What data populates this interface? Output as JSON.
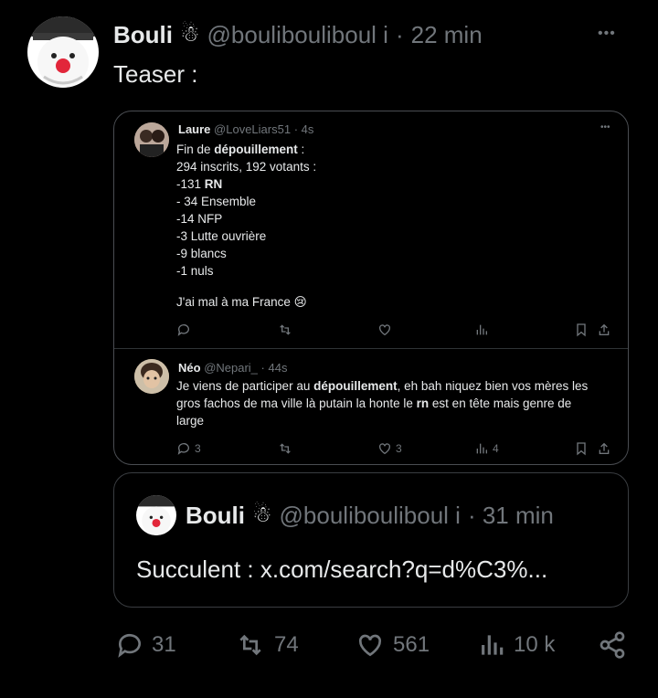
{
  "main": {
    "author_name": "Bouli",
    "author_handle": "@boulibouliboul i",
    "separator": "·",
    "time": "22 min",
    "more": "•••",
    "text": "Teaser :"
  },
  "quoted": {
    "tweet1": {
      "name": "Laure",
      "handle": "@LoveLiars51",
      "time": "· 4s",
      "lines": [
        {
          "pre": "Fin de ",
          "b": "dépouillement",
          "post": " :"
        },
        {
          "pre": "294 inscrits, 192 votants :",
          "b": "",
          "post": ""
        },
        {
          "pre": "-131 ",
          "b": "RN",
          "post": ""
        },
        {
          "pre": "- 34 Ensemble",
          "b": "",
          "post": ""
        },
        {
          "pre": "-14 NFP",
          "b": "",
          "post": ""
        },
        {
          "pre": "-3 Lutte ouvrière",
          "b": "",
          "post": ""
        },
        {
          "pre": "-9 blancs",
          "b": "",
          "post": ""
        },
        {
          "pre": "-1 nuls",
          "b": "",
          "post": ""
        }
      ],
      "last_line": "J'ai mal à ma France 😢"
    },
    "tweet2": {
      "name": "Néo",
      "handle": "@Nepari_",
      "time": "· 44s",
      "line1_pre": "Je viens de participer au ",
      "line1_b": "dépouillement",
      "line1_post": ", eh bah niquez bien vos mères les",
      "line2_pre": "gros fachos de ma ville là putain la honte le ",
      "line2_b": "rn",
      "line2_post": " est en tête mais genre de",
      "line3": "large",
      "replies": "3",
      "likes": "3",
      "views": "4"
    }
  },
  "quote_card": {
    "name": "Bouli",
    "handle": "@boulibouliboul i",
    "time": "· 31 min",
    "text": "Succulent : x.com/search?q=d%C3%..."
  },
  "actions": {
    "replies": "31",
    "reposts": "74",
    "likes": "561",
    "views": "10 k"
  },
  "colors": {
    "background": "#000000",
    "text": "#e7e9ea",
    "muted": "#71767b",
    "border": "#3a3d41"
  }
}
